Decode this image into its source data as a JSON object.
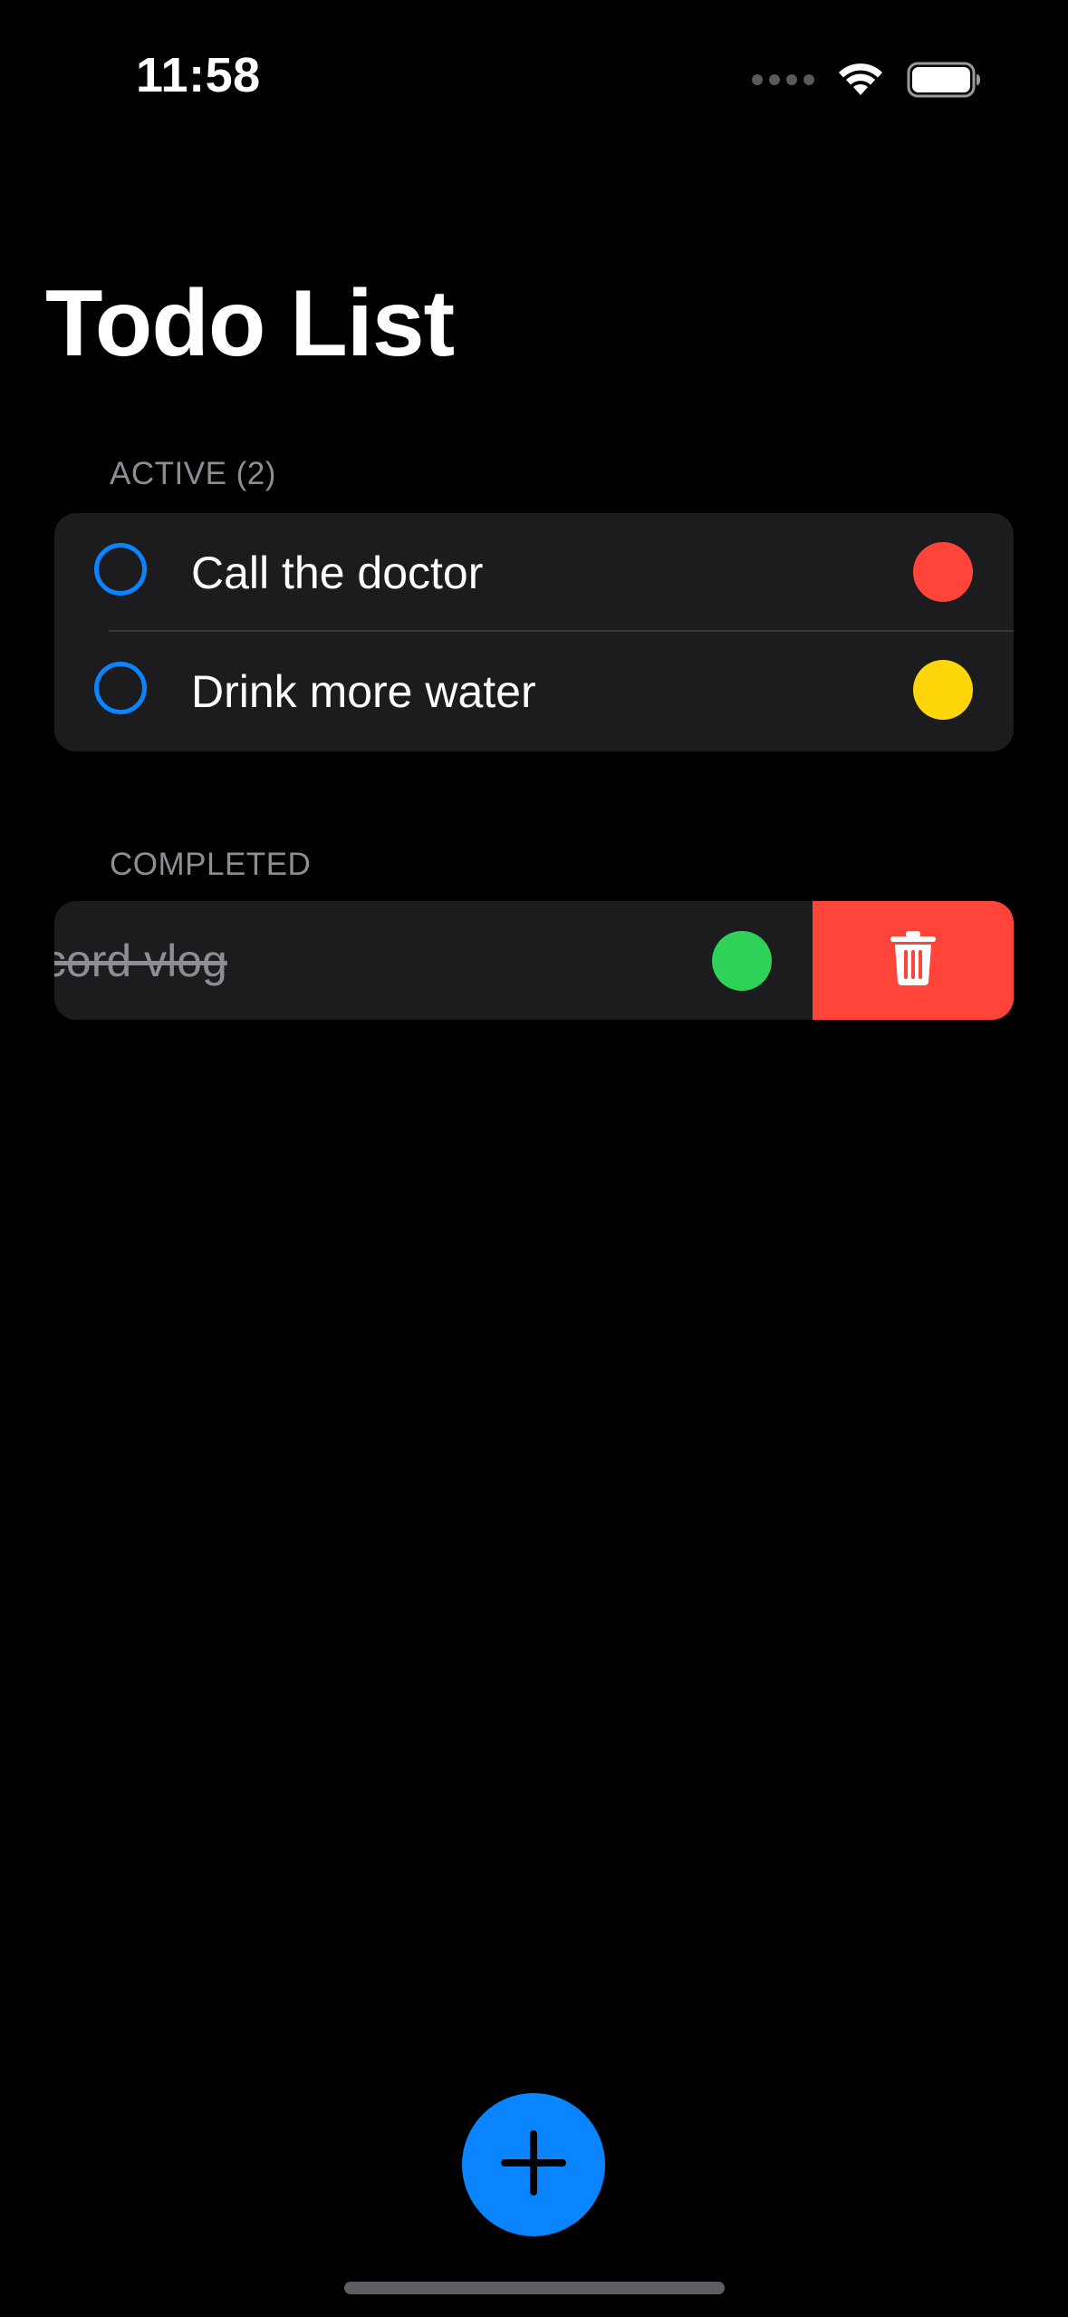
{
  "status_bar": {
    "time": "11:58",
    "wifi_icon": "wifi-icon",
    "battery_icon": "battery-icon"
  },
  "page": {
    "title": "Todo List"
  },
  "sections": {
    "active": {
      "header": "ACTIVE (2)",
      "items": [
        {
          "label": "Call the doctor",
          "priority_color": "#ff453a"
        },
        {
          "label": "Drink more water",
          "priority_color": "#ffd60a"
        }
      ]
    },
    "completed": {
      "header": "COMPLETED",
      "items": [
        {
          "label": "Record vlog",
          "priority_color": "#30d158"
        }
      ],
      "swipe_action_icon": "trash-icon",
      "swipe_action_color": "#ff453a"
    }
  },
  "fab": {
    "icon": "plus-icon",
    "color": "#0a84ff"
  }
}
